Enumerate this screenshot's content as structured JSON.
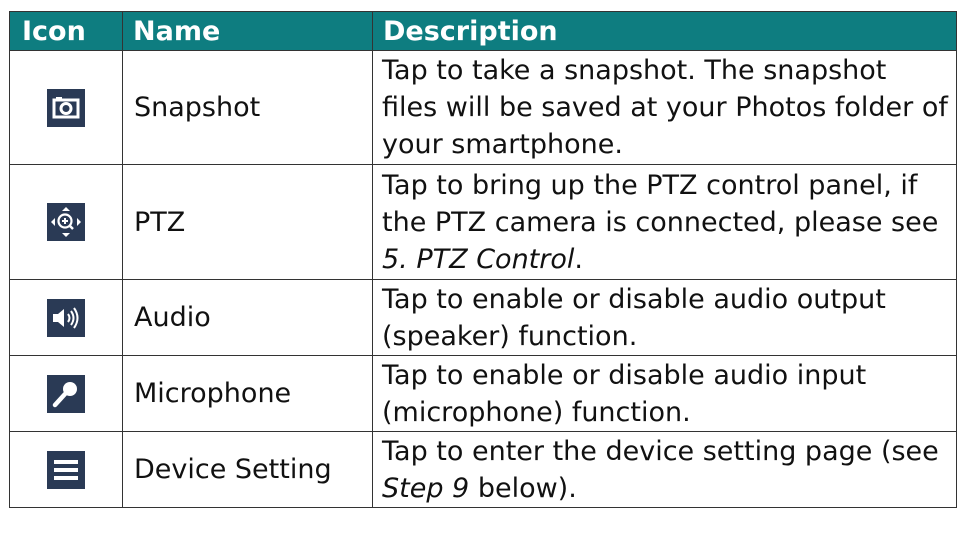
{
  "headers": {
    "icon": "Icon",
    "name": "Name",
    "description": "Description"
  },
  "rows": [
    {
      "icon": "camera-icon",
      "name": "Snapshot",
      "description": "Tap to take a snapshot. The snapshot files will be saved at your Photos folder of your smartphone."
    },
    {
      "icon": "ptz-icon",
      "name": "PTZ",
      "description_pre": "Tap to bring up the PTZ control panel, if the PTZ camera is connected, please see ",
      "description_ref": "5. PTZ Control",
      "description_post": "."
    },
    {
      "icon": "speaker-icon",
      "name": "Audio",
      "description": "Tap to enable or disable audio output (speaker) function."
    },
    {
      "icon": "microphone-icon",
      "name": "Microphone",
      "description": "Tap to enable or disable audio input (microphone) function."
    },
    {
      "icon": "menu-icon",
      "name": "Device Setting",
      "description_pre": "Tap to enter the device setting page (see ",
      "description_ref": "Step 9",
      "description_post": " below)."
    }
  ],
  "colors": {
    "header_bg": "#0e7d80",
    "icon_bg": "#2a3a55"
  }
}
